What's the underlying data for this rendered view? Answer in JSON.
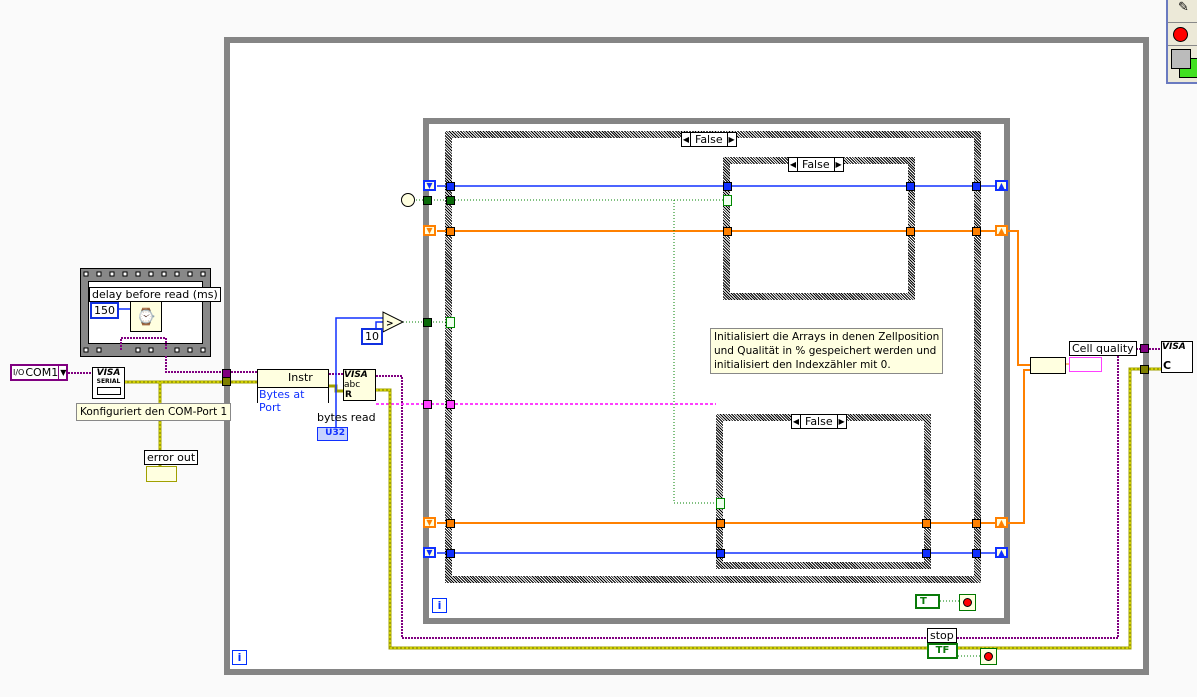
{
  "toolbar": {
    "icons": [
      "probe-icon",
      "breakpoint-icon",
      "palette-icon"
    ]
  },
  "colors": {
    "int_wire": "#0030ff",
    "bool_wire": "#008000",
    "array_wire": "#ff8000",
    "visa_wire": "#800080",
    "error_wire": "#c0c000"
  },
  "sequence": {
    "label": "delay before read (ms)",
    "delay_value": "150"
  },
  "com_control": {
    "value": "COM1"
  },
  "visa_serial": {
    "title": "VISA",
    "subtitle": "SERIAL"
  },
  "comment_config": "Konfiguriert den COM-Port 1",
  "error_out": {
    "label": "error out"
  },
  "property_node": {
    "class": "Instr",
    "property": "Bytes at Port"
  },
  "visa_read": {
    "title": "VISA",
    "sub": "abc",
    "mode": "R"
  },
  "bytes_read": {
    "label": "bytes read",
    "type": "U32"
  },
  "compare_const": "10",
  "outer_case": {
    "selector": "False"
  },
  "inner_case_top": {
    "selector": "False"
  },
  "inner_case_bottom": {
    "selector": "False"
  },
  "comment_init": [
    "Initialisiert die Arrays in denen Zellposition",
    "und Qualität in % gespeichert werden und",
    "initialisiert den Indexzähler mit 0."
  ],
  "cell_quality": {
    "label": "Cell quality"
  },
  "visa_close": {
    "title": "VISA",
    "mode": "C"
  },
  "stop": {
    "label": "stop",
    "control_text": "TF"
  },
  "inner_stop": {
    "control_text": "T"
  },
  "iteration_label": "i"
}
